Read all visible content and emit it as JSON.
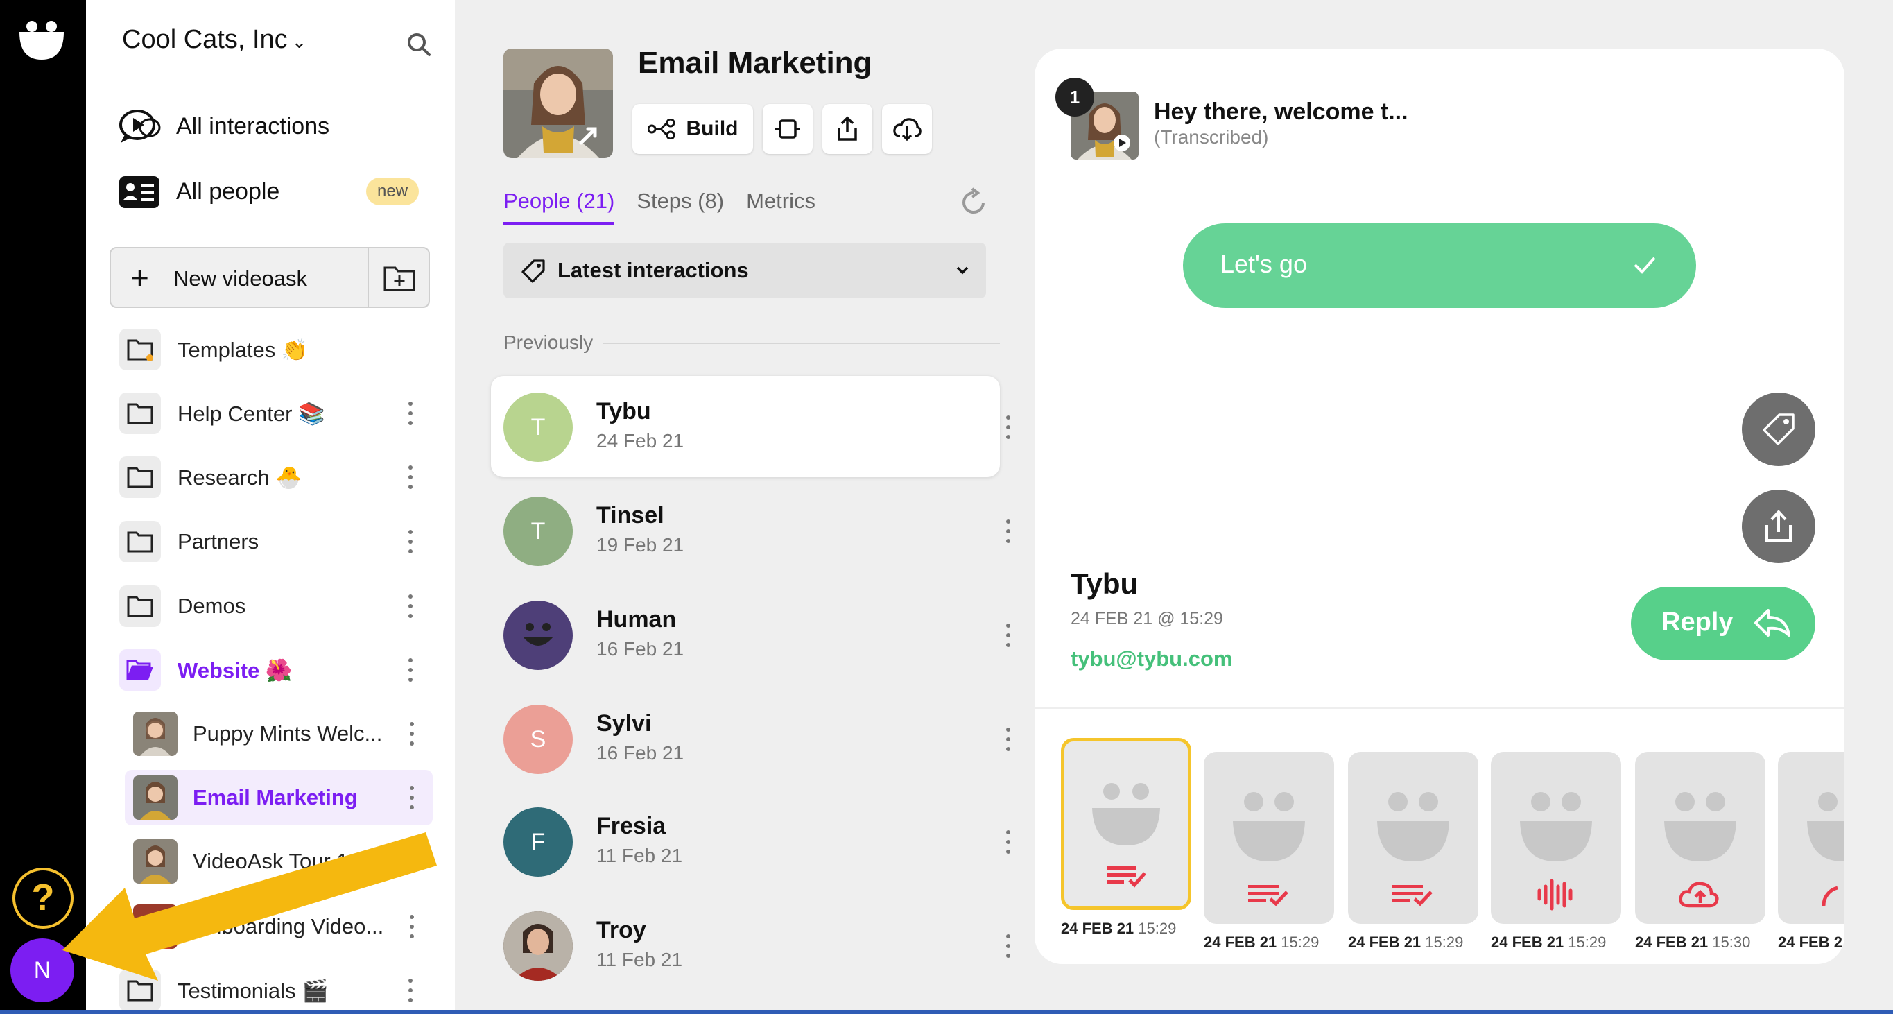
{
  "rail": {
    "help_label": "?",
    "user_initial": "N"
  },
  "sidebar": {
    "org_name": "Cool Cats, Inc",
    "nav": [
      {
        "label": "All interactions",
        "icon": "interactions-icon"
      },
      {
        "label": "All people",
        "icon": "people-icon",
        "badge": "new"
      }
    ],
    "new_button": {
      "plus": "+",
      "label": "New videoask"
    },
    "folders_top": [
      {
        "label": "Templates 👏",
        "has_kebab": false
      },
      {
        "label": "Help Center 📚"
      },
      {
        "label": "Research 🐣"
      },
      {
        "label": "Partners"
      },
      {
        "label": "Demos"
      },
      {
        "label": "Website 🌺",
        "active": true
      }
    ],
    "videos": [
      {
        "label": "Puppy Mints Welc..."
      },
      {
        "label": "Email Marketing",
        "selected": true
      },
      {
        "label": "VideoAsk Tour 1"
      },
      {
        "label": "Onboarding Video..."
      }
    ],
    "folders_bottom": [
      {
        "label": "Testimonials 🎬"
      }
    ]
  },
  "middle": {
    "title": "Email Marketing",
    "build_label": "Build",
    "tabs": [
      "People (21)",
      "Steps (8)",
      "Metrics"
    ],
    "dropdown_label": "Latest interactions",
    "previously_label": "Previously",
    "people": [
      {
        "initial": "T",
        "name": "Tybu",
        "date": "24 Feb 21",
        "color": "#b8d48f"
      },
      {
        "initial": "T",
        "name": "Tinsel",
        "date": "19 Feb 21",
        "color": "#8fae82"
      },
      {
        "initial": "",
        "name": "Human",
        "date": "16 Feb 21",
        "color": "#4e3f78"
      },
      {
        "initial": "S",
        "name": "Sylvi",
        "date": "16 Feb 21",
        "color": "#eb9f96"
      },
      {
        "initial": "F",
        "name": "Fresia",
        "date": "11 Feb 21",
        "color": "#2f6b77"
      },
      {
        "initial": "",
        "name": "Troy",
        "date": "11 Feb 21",
        "color": "#5a4a42"
      }
    ]
  },
  "card": {
    "step_number": "1",
    "step_title": "Hey there, welcome t...",
    "step_subtitle": "(Transcribed)",
    "answer_label": "Let's go",
    "responder_name": "Tybu",
    "responder_date": "24 FEB 21 @ 15:29",
    "responder_email": "tybu@tybu.com",
    "reply_label": "Reply",
    "timeline": [
      {
        "date": "24 FEB 21",
        "time": "15:29",
        "icon": "text-check-icon"
      },
      {
        "date": "24 FEB 21",
        "time": "15:29",
        "icon": "text-check-icon"
      },
      {
        "date": "24 FEB 21",
        "time": "15:29",
        "icon": "text-check-icon"
      },
      {
        "date": "24 FEB 21",
        "time": "15:29",
        "icon": "audio-icon"
      },
      {
        "date": "24 FEB 21",
        "time": "15:30",
        "icon": "upload-cloud-icon"
      },
      {
        "date": "24 FEB 2",
        "time": "",
        "icon": "gauge-icon"
      }
    ]
  },
  "colors": {
    "accent": "#7c1ef2",
    "green": "#66d396",
    "red": "#e8394a",
    "yellow": "#f5c52c"
  }
}
